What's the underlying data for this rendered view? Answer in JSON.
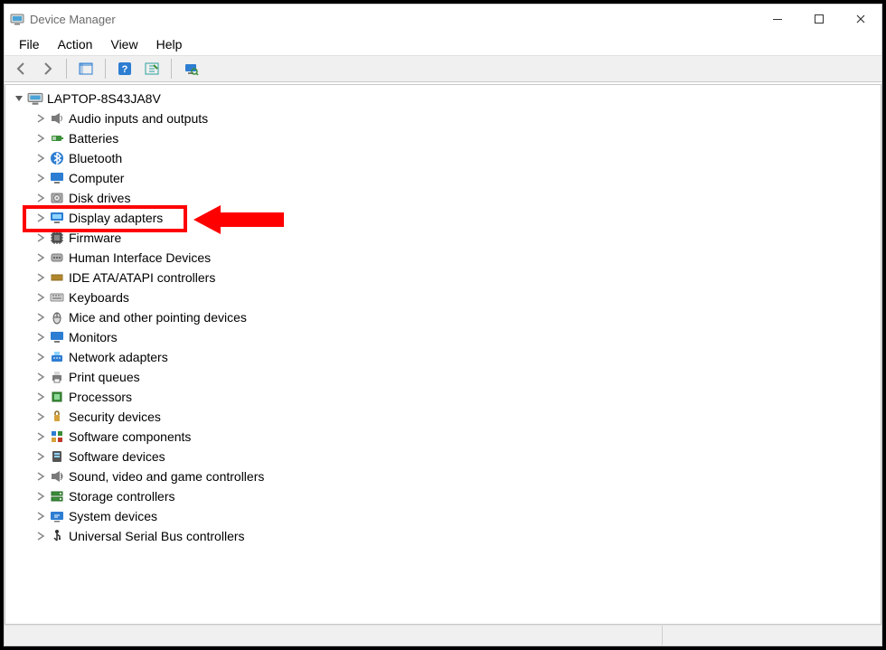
{
  "window": {
    "title": "Device Manager"
  },
  "menu": {
    "file": "File",
    "action": "Action",
    "view": "View",
    "help": "Help"
  },
  "toolbar": {
    "back": "Back",
    "forward": "Forward",
    "show_hide_tree": "Show/Hide Console Tree",
    "help_btn": "Help",
    "show_hidden": "Show hidden devices",
    "scan": "Scan for hardware changes"
  },
  "tree": {
    "root": {
      "label": "LAPTOP-8S43JA8V",
      "expanded": true,
      "icon": "computer-icon"
    },
    "items": [
      {
        "label": "Audio inputs and outputs",
        "icon": "audio-icon"
      },
      {
        "label": "Batteries",
        "icon": "battery-icon"
      },
      {
        "label": "Bluetooth",
        "icon": "bluetooth-icon"
      },
      {
        "label": "Computer",
        "icon": "monitor-icon"
      },
      {
        "label": "Disk drives",
        "icon": "disk-icon"
      },
      {
        "label": "Display adapters",
        "icon": "display-icon",
        "highlighted": true
      },
      {
        "label": "Firmware",
        "icon": "chip-icon"
      },
      {
        "label": "Human Interface Devices",
        "icon": "hid-icon"
      },
      {
        "label": "IDE ATA/ATAPI controllers",
        "icon": "ide-icon"
      },
      {
        "label": "Keyboards",
        "icon": "keyboard-icon"
      },
      {
        "label": "Mice and other pointing devices",
        "icon": "mouse-icon"
      },
      {
        "label": "Monitors",
        "icon": "monitor-icon"
      },
      {
        "label": "Network adapters",
        "icon": "network-icon"
      },
      {
        "label": "Print queues",
        "icon": "printer-icon"
      },
      {
        "label": "Processors",
        "icon": "cpu-icon"
      },
      {
        "label": "Security devices",
        "icon": "security-icon"
      },
      {
        "label": "Software components",
        "icon": "component-icon"
      },
      {
        "label": "Software devices",
        "icon": "software-icon"
      },
      {
        "label": "Sound, video and game controllers",
        "icon": "sound-icon"
      },
      {
        "label": "Storage controllers",
        "icon": "storage-icon"
      },
      {
        "label": "System devices",
        "icon": "system-icon"
      },
      {
        "label": "Universal Serial Bus controllers",
        "icon": "usb-icon"
      }
    ]
  },
  "annotation": {
    "highlight_target": "Display adapters",
    "highlight_color": "#ff0000",
    "arrow_color": "#ff0000"
  }
}
